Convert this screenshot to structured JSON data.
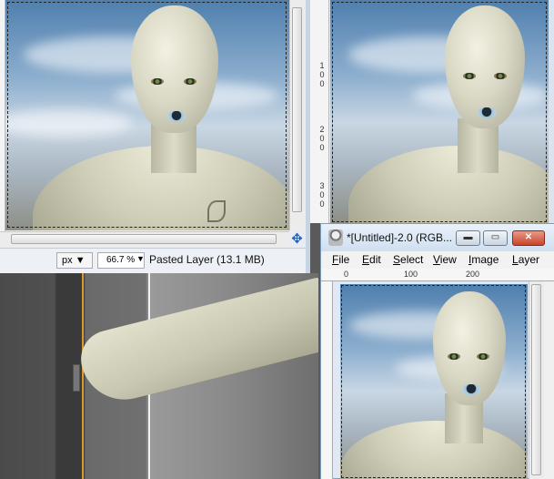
{
  "background_canvas": {
    "description_colors": {
      "guide_orange": "#d89a2a",
      "guide_white": "#f0f0f0"
    }
  },
  "window_top_left": {
    "unit": "px",
    "zoom": "66.7 %",
    "layer_info": "Pasted Layer (13.1 MB)",
    "navigate_icon": "navigate-icon"
  },
  "window_top_right": {
    "ruler_labels": [
      "1",
      "0",
      "0",
      "2",
      "0",
      "0",
      "3",
      "0",
      "0"
    ]
  },
  "window_small": {
    "title": "*[Untitled]-2.0 (RGB...",
    "buttons": {
      "minimize": "▬",
      "maximize": "▭",
      "close": "✕"
    },
    "menu": [
      {
        "label": "File",
        "accel": "F",
        "rest": "ile"
      },
      {
        "label": "Edit",
        "accel": "E",
        "rest": "dit"
      },
      {
        "label": "Select",
        "accel": "S",
        "rest": "elect"
      },
      {
        "label": "View",
        "accel": "V",
        "rest": "iew"
      },
      {
        "label": "Image",
        "accel": "I",
        "rest": "mage"
      },
      {
        "label": "Layer",
        "accel": "L",
        "rest": "ayer"
      }
    ],
    "ruler_labels": [
      "0",
      "100",
      "200"
    ]
  }
}
